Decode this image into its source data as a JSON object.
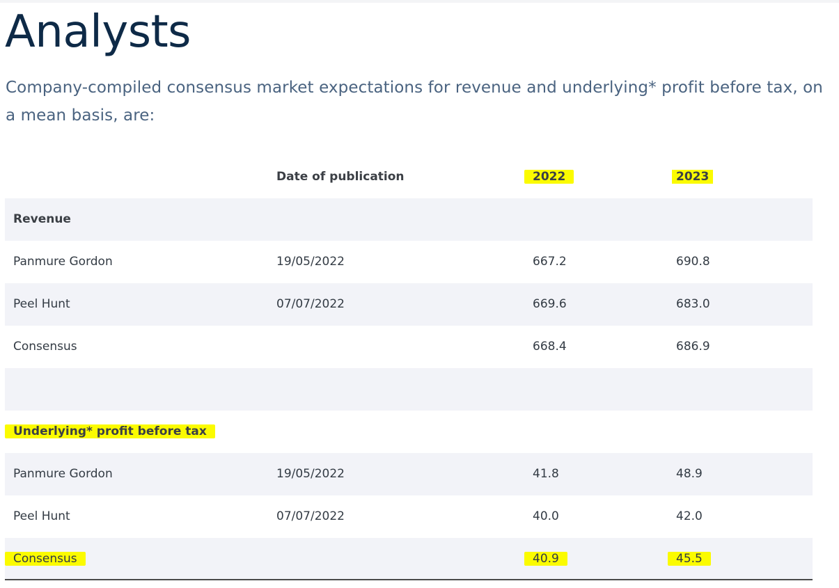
{
  "page": {
    "title": "Analysts",
    "intro": "Company-compiled consensus market expectations for revenue and underlying* profit before tax, on a mean basis, are:"
  },
  "table": {
    "headers": {
      "name": "",
      "date": "Date of publication",
      "y2022": "2022",
      "y2023": "2023"
    },
    "revenue": {
      "section_label": "Revenue",
      "rows": [
        {
          "name": "Panmure Gordon",
          "date": "19/05/2022",
          "y2022": "667.2",
          "y2023": "690.8"
        },
        {
          "name": "Peel Hunt",
          "date": "07/07/2022",
          "y2022": "669.6",
          "y2023": "683.0"
        },
        {
          "name": "Consensus",
          "date": "",
          "y2022": "668.4",
          "y2023": "686.9"
        }
      ]
    },
    "profit": {
      "section_label": "Underlying* profit before tax",
      "rows": [
        {
          "name": "Panmure Gordon",
          "date": "19/05/2022",
          "y2022": "41.8",
          "y2023": "48.9"
        },
        {
          "name": "Peel Hunt",
          "date": "07/07/2022",
          "y2022": "40.0",
          "y2023": "42.0"
        },
        {
          "name": "Consensus",
          "date": "",
          "y2022": "40.9",
          "y2023": "45.5"
        }
      ]
    }
  },
  "colors": {
    "title": "#0e2a47",
    "intro": "#4a6380",
    "row_shade": "#f2f3f8",
    "highlight": "#fbfb00"
  }
}
